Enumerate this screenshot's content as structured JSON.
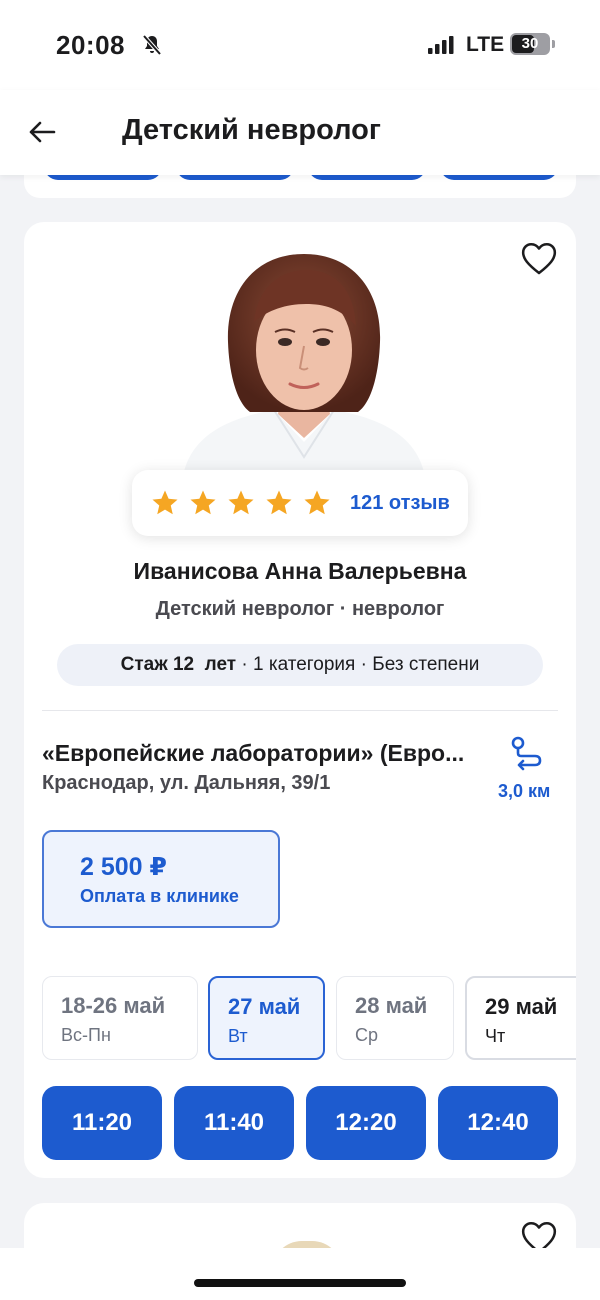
{
  "status_bar": {
    "time": "20:08",
    "network": "LTE",
    "battery": "30"
  },
  "header": {
    "title": "Детский невролог"
  },
  "doctor_card": {
    "rating": {
      "stars": 5,
      "reviews_label": "121 отзыв"
    },
    "name": "Иванисова Анна Валерьевна",
    "specialty": "Детский невролог · невролог",
    "experience": {
      "label": "Стаж 12  лет",
      "rest": " · 1 категория · Без степени"
    },
    "clinic": {
      "name": "«Европейские лаборатории» (Евро...",
      "address": "Краснодар, ул. Дальняя, 39/1",
      "distance": "3,0 км"
    },
    "price": {
      "amount": "2 500 ₽",
      "note": "Оплата в клинике"
    },
    "dates": [
      {
        "date": "18-26 май",
        "weekday": "Вс-Пн",
        "state": "unavailable"
      },
      {
        "date": "27 май",
        "weekday": "Вт",
        "state": "selected"
      },
      {
        "date": "28 май",
        "weekday": "Ср",
        "state": "unavailable"
      },
      {
        "date": "29 май",
        "weekday": "Чт",
        "state": "available"
      }
    ],
    "time_slots": [
      "11:20",
      "11:40",
      "12:20",
      "12:40"
    ]
  },
  "colors": {
    "accent": "#1d5bcf",
    "star": "#f5a623",
    "background": "#f2f3f6"
  },
  "icons": {
    "back": "arrow-left-icon",
    "favorite": "heart-outline-icon",
    "route": "route-icon",
    "bell_muted": "bell-slash-icon"
  }
}
